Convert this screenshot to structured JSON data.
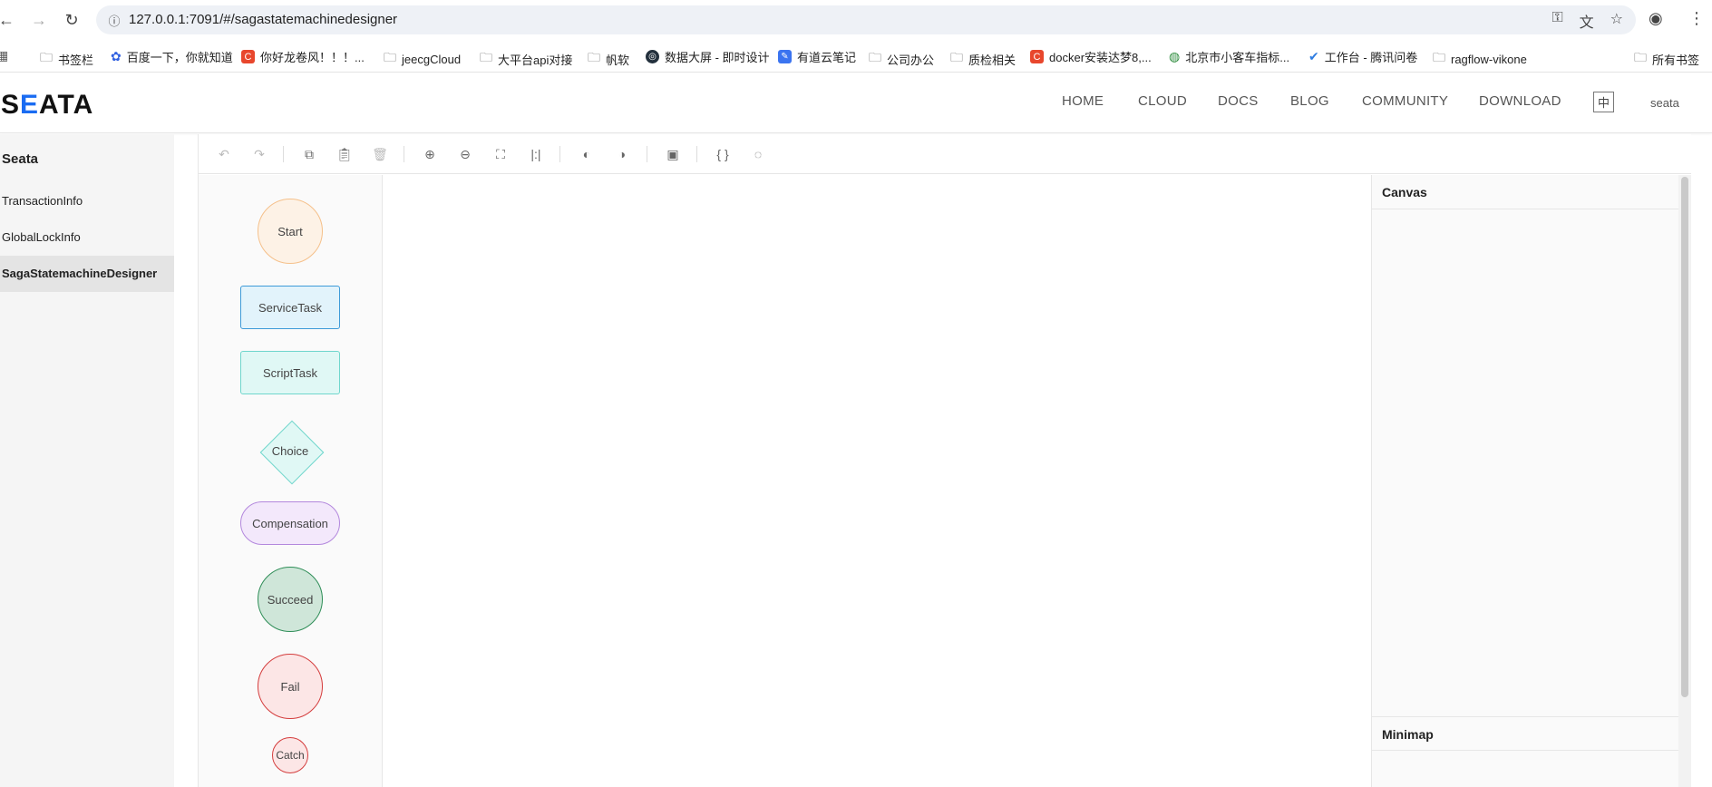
{
  "browser": {
    "url": "127.0.0.1:7091/#/sagastatemachinedesigner",
    "bookmarks": [
      {
        "label": "书签栏",
        "icon": "folder"
      },
      {
        "label": "百度一下，你就知道",
        "icon": "baidu"
      },
      {
        "label": "你好龙卷风！！！...",
        "icon": "c-red"
      },
      {
        "label": "jeecgCloud",
        "icon": "folder"
      },
      {
        "label": "大平台api对接",
        "icon": "folder"
      },
      {
        "label": "帆软",
        "icon": "folder"
      },
      {
        "label": "数据大屏 - 即时设计",
        "icon": "js-design"
      },
      {
        "label": "有道云笔记",
        "icon": "youdao"
      },
      {
        "label": "公司办公",
        "icon": "folder"
      },
      {
        "label": "质检相关",
        "icon": "folder"
      },
      {
        "label": "docker安装达梦8,...",
        "icon": "c-red"
      },
      {
        "label": "北京市小客车指标...",
        "icon": "globe"
      },
      {
        "label": "工作台 - 腾讯问卷",
        "icon": "check"
      },
      {
        "label": "ragflow-vikone",
        "icon": "folder"
      },
      {
        "label": "所有书签",
        "icon": "folder"
      }
    ]
  },
  "header": {
    "logo": "SEATA",
    "nav": [
      "HOME",
      "CLOUD",
      "DOCS",
      "BLOG",
      "COMMUNITY",
      "DOWNLOAD"
    ],
    "lang": "中",
    "user": "seata"
  },
  "sidebar": {
    "title": "Seata",
    "items": [
      {
        "label": "TransactionInfo",
        "active": false
      },
      {
        "label": "GlobalLockInfo",
        "active": false
      },
      {
        "label": "SagaStatemachineDesigner",
        "active": true
      }
    ]
  },
  "toolbar": {
    "buttons": [
      "undo-icon",
      "redo-icon",
      "copy-icon",
      "paste-icon",
      "delete-icon",
      "zoom-in-icon",
      "zoom-out-icon",
      "fit-view-icon",
      "actual-size-icon",
      "bring-front-icon",
      "send-back-icon",
      "export-image-icon",
      "json-icon",
      "theme-icon"
    ]
  },
  "itempanel": {
    "nodes": [
      "Start",
      "ServiceTask",
      "ScriptTask",
      "Choice",
      "Compensation",
      "Succeed",
      "Fail",
      "Catch"
    ]
  },
  "detailpanel": {
    "canvas_title": "Canvas",
    "minimap_title": "Minimap"
  },
  "colors": {
    "accent": "#1a6cf2",
    "start_border": "#f5c08a",
    "service_border": "#3e9ad8",
    "script_border": "#6fd6cc",
    "compensation_border": "#b387dd",
    "succeed_border": "#2f8e58",
    "fail_border": "#d43d3d"
  }
}
